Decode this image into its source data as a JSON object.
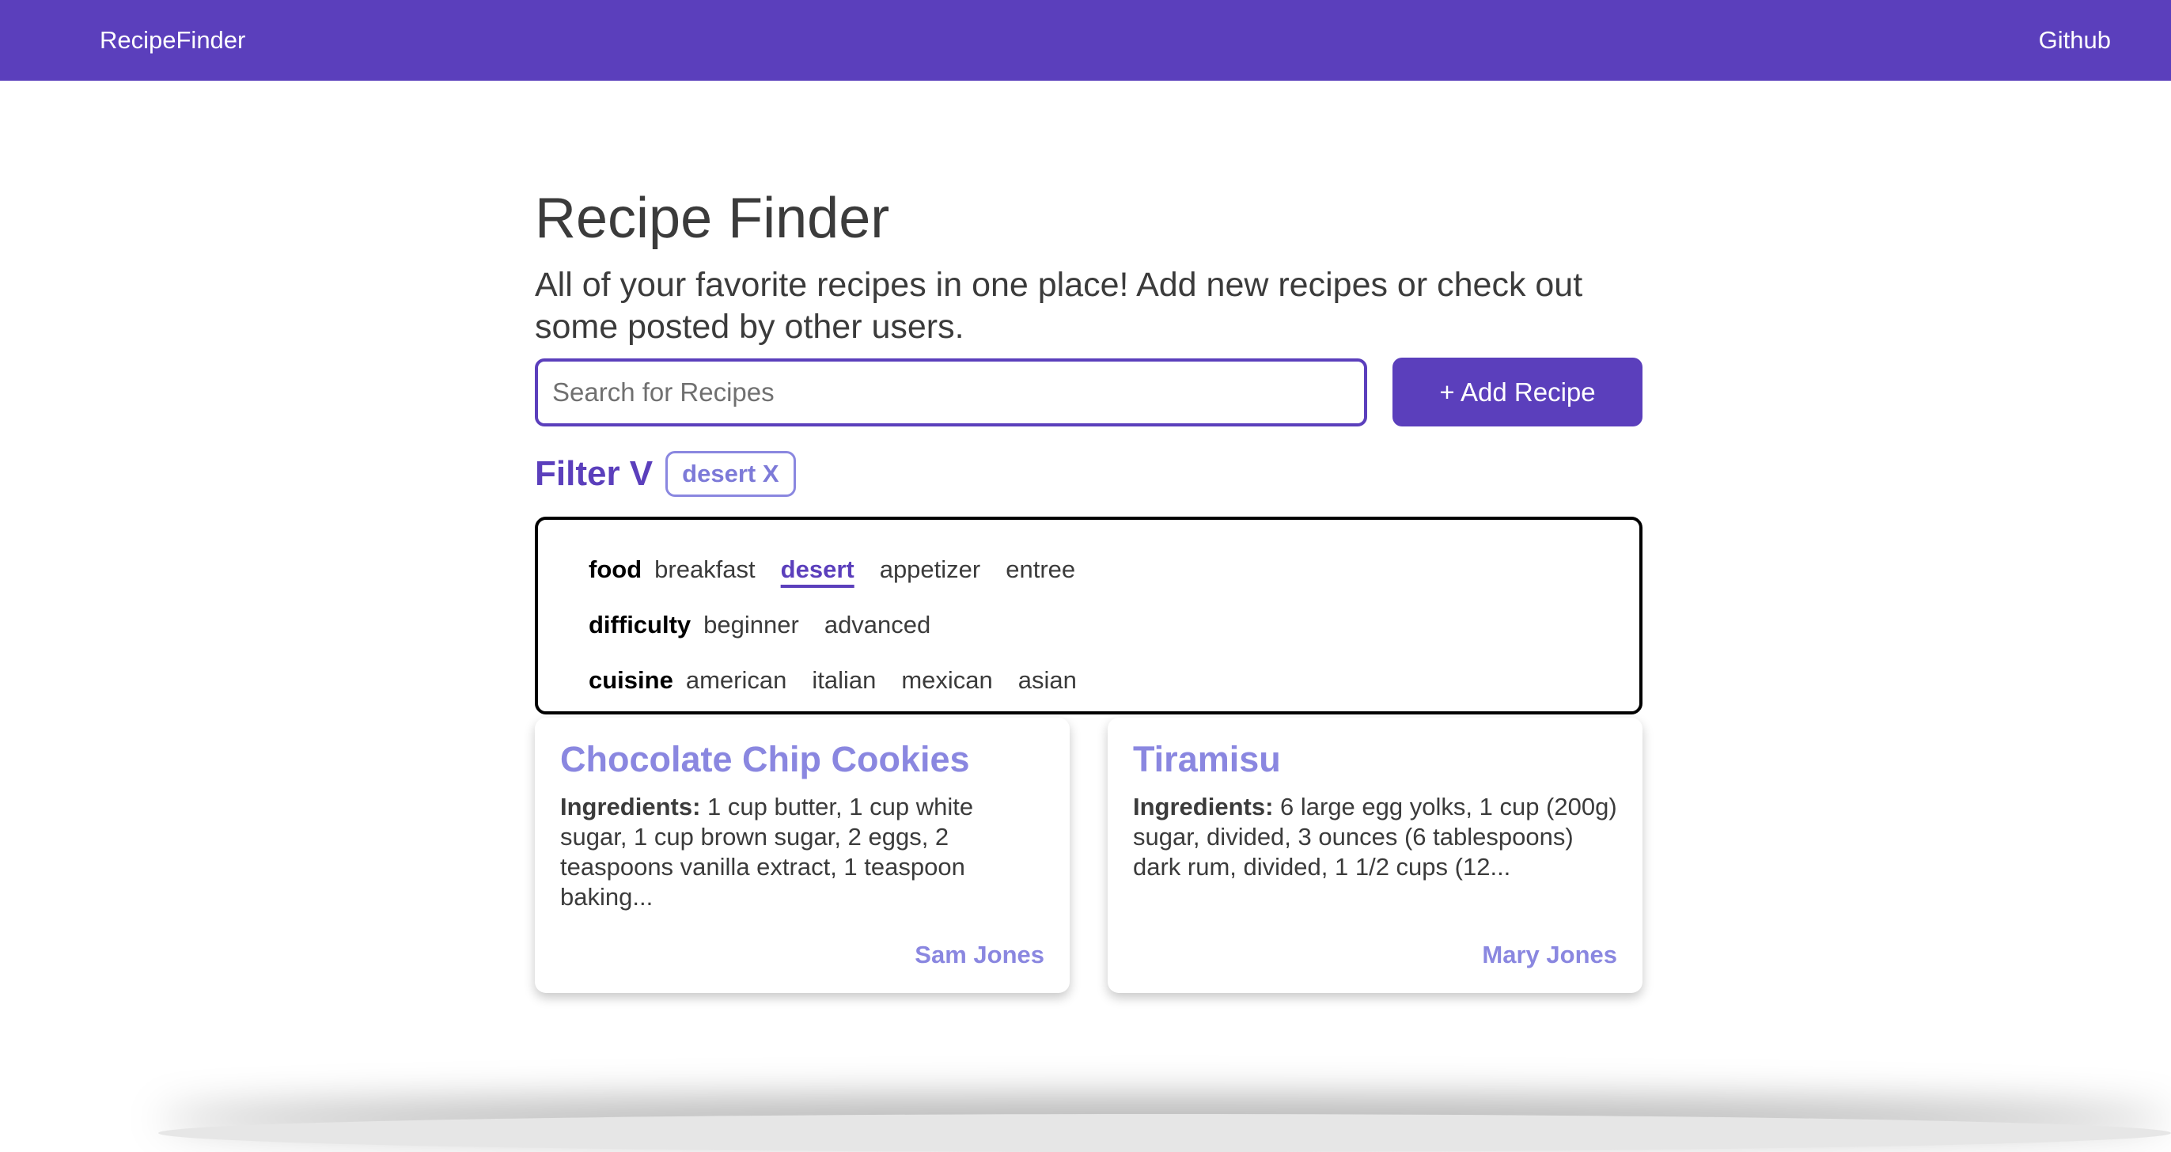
{
  "navbar": {
    "brand": "RecipeFinder",
    "github_link": "Github"
  },
  "header": {
    "title": "Recipe Finder",
    "subtitle": "All of your favorite recipes in one place! Add new recipes or check out some posted by other users."
  },
  "search": {
    "placeholder": "Search for Recipes",
    "value": ""
  },
  "add_button_label": "+ Add Recipe",
  "filter": {
    "toggle_label": "Filter V",
    "active_chips": [
      "desert X"
    ],
    "groups": [
      {
        "label": "food",
        "options": [
          "breakfast",
          "desert",
          "appetizer",
          "entree"
        ],
        "selected": "desert"
      },
      {
        "label": "difficulty",
        "options": [
          "beginner",
          "advanced"
        ],
        "selected": null
      },
      {
        "label": "cuisine",
        "options": [
          "american",
          "italian",
          "mexican",
          "asian"
        ],
        "selected": null
      }
    ]
  },
  "recipes": [
    {
      "title": "Chocolate Chip Cookies",
      "ingredients_label": "Ingredients:",
      "ingredients": "1 cup butter, 1 cup white sugar, 1 cup brown sugar, 2 eggs, 2 teaspoons vanilla extract, 1 teaspoon baking...",
      "author": "Sam Jones"
    },
    {
      "title": "Tiramisu",
      "ingredients_label": "Ingredients:",
      "ingredients": "6 large egg yolks, 1 cup (200g) sugar, divided, 3 ounces (6 tablespoons) dark rum, divided, 1 1/2 cups (12...",
      "author": "Mary Jones"
    }
  ],
  "colors": {
    "primary": "#5b3fbc",
    "accent_light": "#8a87e0",
    "text": "#3b3b3b"
  }
}
